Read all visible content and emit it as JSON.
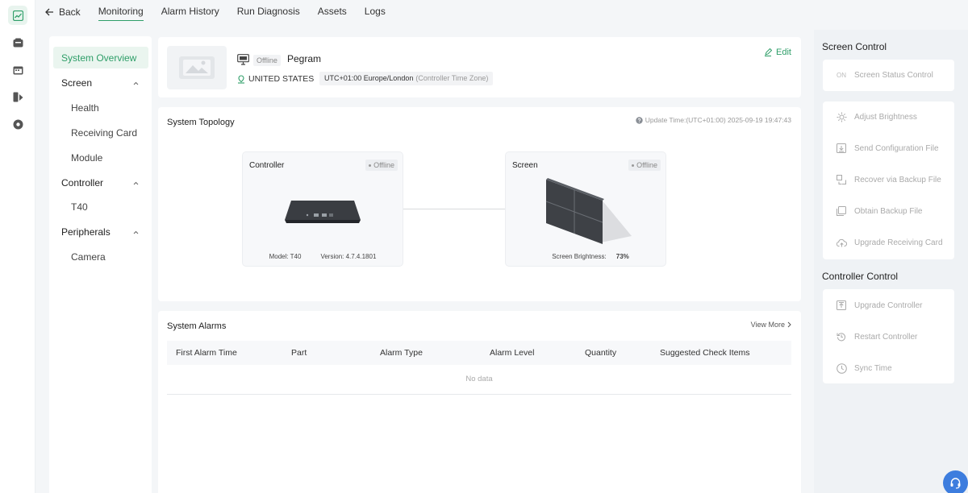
{
  "rail": {
    "icons": [
      "monitoring-icon",
      "device-icon",
      "calendar-icon",
      "media-icon",
      "settings-icon"
    ]
  },
  "topnav": {
    "back_label": "Back",
    "tabs": [
      {
        "label": "Monitoring",
        "active": true
      },
      {
        "label": "Alarm History",
        "active": false
      },
      {
        "label": "Run Diagnosis",
        "active": false
      },
      {
        "label": "Assets",
        "active": false
      },
      {
        "label": "Logs",
        "active": false
      }
    ]
  },
  "leftnav": {
    "system_overview": "System Overview",
    "screen": "Screen",
    "health": "Health",
    "receiving_card": "Receiving Card",
    "module": "Module",
    "controller": "Controller",
    "t40": "T40",
    "peripherals": "Peripherals",
    "camera": "Camera"
  },
  "device": {
    "status": "Offline",
    "name": "Pegram",
    "country": "UNITED STATES",
    "timezone": "UTC+01:00 Europe/London",
    "timezone_note": "(Controller Time Zone)",
    "edit_label": "Edit"
  },
  "topology": {
    "title": "System Topology",
    "update_time": "Update Time:(UTC+01:00) 2025-09-19 19:47:43",
    "controller": {
      "title": "Controller",
      "status": "Offline",
      "model": "Model: T40",
      "version": "Version: 4.7.4.1801"
    },
    "screen": {
      "title": "Screen",
      "status": "Offline",
      "brightness_label": "Screen Brightness:",
      "brightness_value": "73%"
    }
  },
  "alarms": {
    "title": "System Alarms",
    "view_more": "View More",
    "columns": [
      "First Alarm Time",
      "Part",
      "Alarm Type",
      "Alarm Level",
      "Quantity",
      "Suggested Check Items"
    ],
    "empty_text": "No data"
  },
  "screen_control": {
    "title": "Screen Control",
    "status_badge": "ON",
    "status_label": "Screen Status Control",
    "items": [
      {
        "label": "Adjust Brightness",
        "icon": "brightness-icon"
      },
      {
        "label": "Send Configuration File",
        "icon": "send-file-icon"
      },
      {
        "label": "Recover via Backup File",
        "icon": "recover-icon"
      },
      {
        "label": "Obtain Backup File",
        "icon": "backup-icon"
      },
      {
        "label": "Upgrade Receiving Card",
        "icon": "upgrade-card-icon"
      }
    ]
  },
  "controller_control": {
    "title": "Controller Control",
    "items": [
      {
        "label": "Upgrade Controller",
        "icon": "upgrade-icon"
      },
      {
        "label": "Restart Controller",
        "icon": "restart-icon"
      },
      {
        "label": "Sync Time",
        "icon": "clock-icon"
      }
    ]
  },
  "colors": {
    "accent": "#2e9e68",
    "help_button": "#3d7dde"
  }
}
